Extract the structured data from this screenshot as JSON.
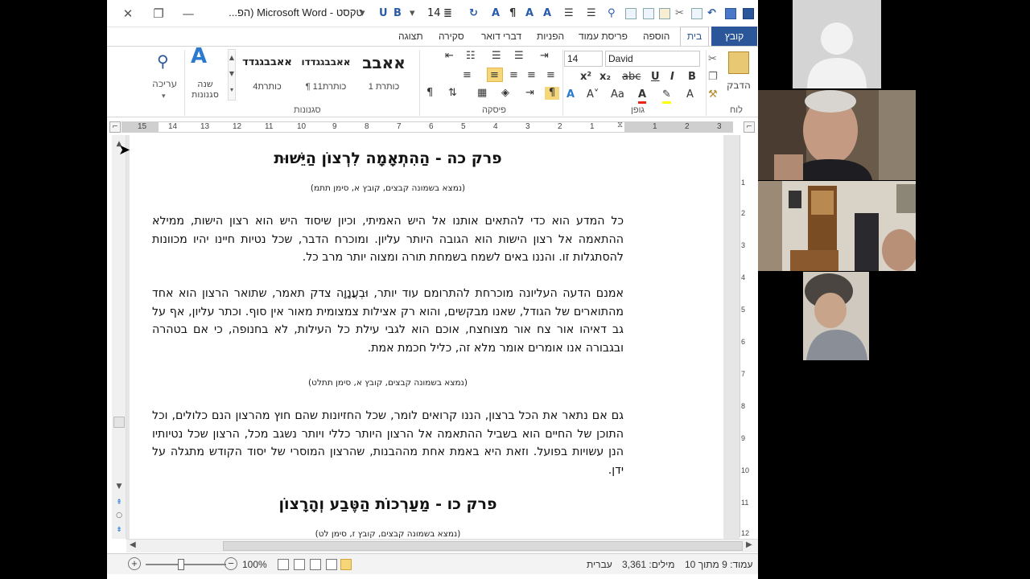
{
  "window": {
    "title": "טקסט - Microsoft Word (הפ...",
    "font_size_qat": "14"
  },
  "tabs": {
    "file": "קובץ",
    "home": "בית",
    "insert": "הוספה",
    "page_layout": "פריסת עמוד",
    "references": "הפניות",
    "mailings": "דברי דואר",
    "review": "סקירה",
    "view": "תצוגה"
  },
  "ribbon": {
    "groups": {
      "clipboard": "לוח",
      "font": "גופן",
      "paragraph": "פיסקה",
      "styles": "סגנונות"
    },
    "paste_label": "הדבק",
    "font_name": "David",
    "font_size": "14",
    "styles": [
      {
        "sample": "אאבב",
        "name": "כותרת 1"
      },
      {
        "sample": "אאבבגגדדו",
        "name": "¶ כותרת11"
      },
      {
        "sample": "אאבבגגדד",
        "name": "כותרת4"
      }
    ],
    "change_styles_label": "שנה סגנונות",
    "editing_label": "עריכה",
    "colors": {
      "accent": "#2b579a",
      "active_align": "#f5d77a"
    }
  },
  "ruler": {
    "h_numbers": [
      "15",
      "14",
      "13",
      "12",
      "11",
      "10",
      "9",
      "8",
      "7",
      "6",
      "5",
      "4",
      "3",
      "2",
      "1",
      "1",
      "2",
      "3"
    ],
    "v_numbers": [
      "1",
      "2",
      "3",
      "4",
      "5",
      "6",
      "7",
      "8",
      "9",
      "10",
      "11",
      "12"
    ]
  },
  "document": {
    "heading1": "פרק כה - הַהִתְאָמָה לִרְצוֹן הַיֵּשׁוּת",
    "source1": "(נמצא בשמונה קבצים, קובץ א, סימן תתמ)",
    "para1": "כל המדע הוא כדי להתאים אותנו אל היש האמיתי, וכיון שיסוד היש הוא רצון הישות, ממילא ההתאמה אל רצון הישות הוא הגובה היותר עליון. ומוכרח הדבר, שכל נטיות חיינו יהיו מכוונות להסתגלות זו. והננו באים לשמח בשמחת תורה ומצוה יותר מרב כל.",
    "para2": "אמנם הדעה העליונה מוכרחת להתרומם עוד יותר, וּבְעֲנָוָה צדק תאמר, שתואר הרצון הוא אחד מהתוארים של הגודל, שאנו מבקשים, והוא רק אצילות צמצומית מאור אין סוף. וכתר עליון, אף על גב דאיהו אור צח אור מצוחצח, אוכם הוא לגבי עילת כל העילות, לא בחנופה, כי אם בטהרה ובגבורה אנו אומרים אומר מלא זה, כליל חכמת אמת.",
    "source2": "(נמצא בשמונה קבצים, קובץ א, סימן תתלט)",
    "para3": "גם אם נתאר את הכל ברצון, הננו קרואים לומר, שכל החזיונות שהם חוץ מהרצון הנם כלולים, וכל התוכן של החיים הוא בשביל ההתאמה אל הרצון היותר כללי ויותר נשגב מכל, הרצון שכל נטיותיו הנן עשויות בפועל. וזאת היא באמת אחת מההבנות, שהרצון המוסרי של יסוד הקודש מתגלה על ידן.",
    "heading2": "פרק כו - מַעַרְכוֹת הַטֶּבַע וְהָרָצוֹן",
    "source3": "(נמצא בשמונה קבצים, קובץ ז, סימן לט)"
  },
  "status": {
    "page": "עמוד: 9 מתוך 10",
    "words": "מילים: 3,361",
    "language": "עברית",
    "zoom": "100%"
  },
  "icons": {
    "close": "close-icon",
    "restore": "restore-icon",
    "minimize": "minimize-icon",
    "help": "help-icon",
    "save": "save-icon",
    "undo": "undo-icon"
  }
}
